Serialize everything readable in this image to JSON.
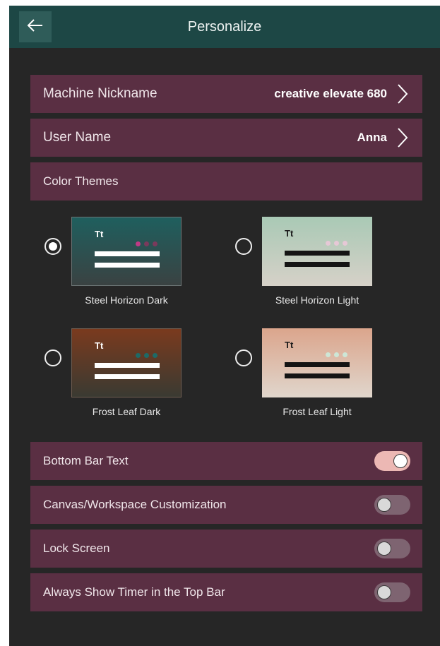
{
  "header": {
    "title": "Personalize",
    "back_icon": "arrow-left-icon"
  },
  "settings": {
    "machine_nickname": {
      "label": "Machine Nickname",
      "value": "creative elevate 680"
    },
    "user_name": {
      "label": "User Name",
      "value": "Anna"
    },
    "color_themes": {
      "label": "Color Themes"
    }
  },
  "themes": [
    {
      "name": "Steel Horizon Dark",
      "selected": true,
      "sample_text": "Tt"
    },
    {
      "name": "Steel Horizon Light",
      "selected": false,
      "sample_text": "Tt"
    },
    {
      "name": "Frost Leaf Dark",
      "selected": false,
      "sample_text": "Tt"
    },
    {
      "name": "Frost Leaf Light",
      "selected": false,
      "sample_text": "Tt"
    }
  ],
  "toggles": [
    {
      "label": "Bottom Bar Text",
      "on": true
    },
    {
      "label": "Canvas/Workspace Customization",
      "on": false
    },
    {
      "label": "Lock Screen",
      "on": false
    },
    {
      "label": "Always Show Timer in the Top Bar",
      "on": false
    }
  ],
  "colors": {
    "topbar": "#1d4745",
    "row": "#5a2f43",
    "background": "#262626",
    "toggle_on": "#ecb8b4",
    "toggle_off": "#7e6471"
  }
}
